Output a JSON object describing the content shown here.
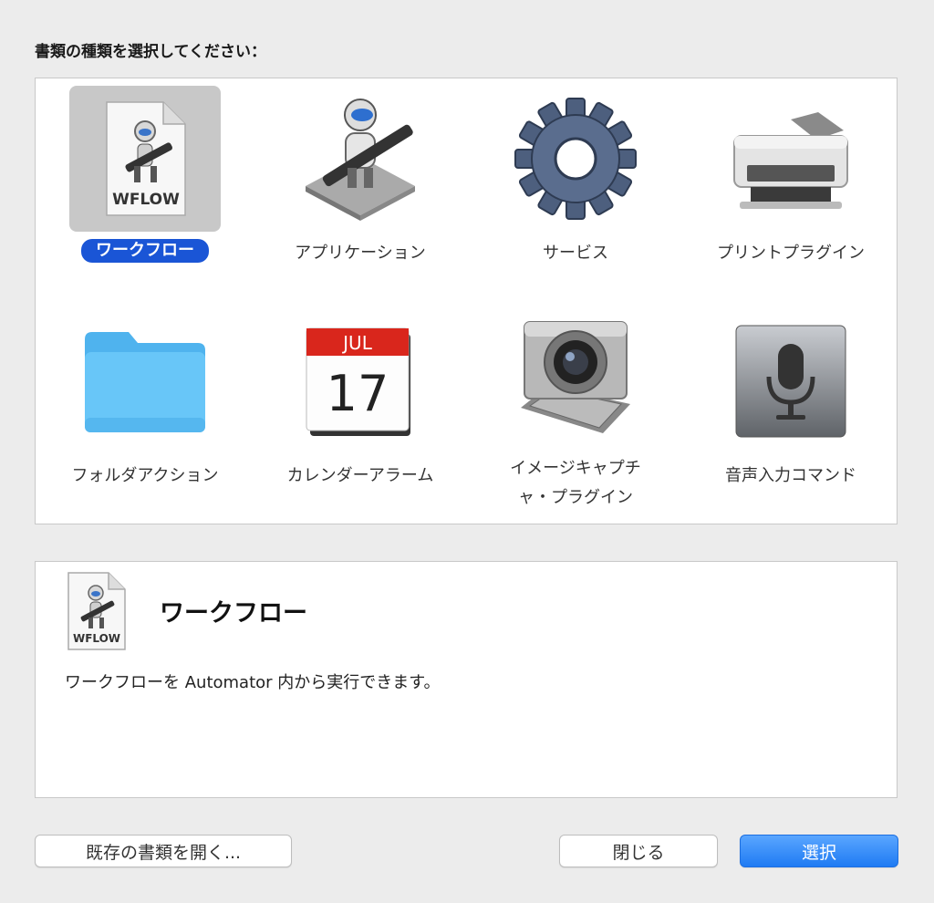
{
  "heading": "書類の種類を選択してください：",
  "items": [
    {
      "label": "ワークフロー",
      "icon": "workflow-document-icon",
      "selected": true
    },
    {
      "label": "アプリケーション",
      "icon": "automator-robot-icon"
    },
    {
      "label": "サービス",
      "icon": "gear-icon"
    },
    {
      "label": "プリントプラグイン",
      "icon": "printer-icon"
    },
    {
      "label": "フォルダアクション",
      "icon": "folder-icon"
    },
    {
      "label": "カレンダーアラーム",
      "icon": "calendar-icon",
      "month": "JUL",
      "day": "17"
    },
    {
      "label": "イメージキャプチャ・プラグイン",
      "label_line1": "イメージキャプチ",
      "label_line2": "ャ・プラグイン",
      "icon": "camera-icon"
    },
    {
      "label": "音声入力コマンド",
      "icon": "microphone-icon"
    }
  ],
  "workflow_doc_text": "WFLOW",
  "description": {
    "title": "ワークフロー",
    "text": "ワークフローを Automator 内から実行できます。",
    "icon_text": "WFLOW"
  },
  "buttons": {
    "open_existing": "既存の書類を開く...",
    "close": "閉じる",
    "choose": "選択"
  },
  "colors": {
    "selection": "#1a55d6",
    "primary_button": "#1f7bf3",
    "folder": "#5ec2f7",
    "calendar_header": "#d9261c"
  }
}
